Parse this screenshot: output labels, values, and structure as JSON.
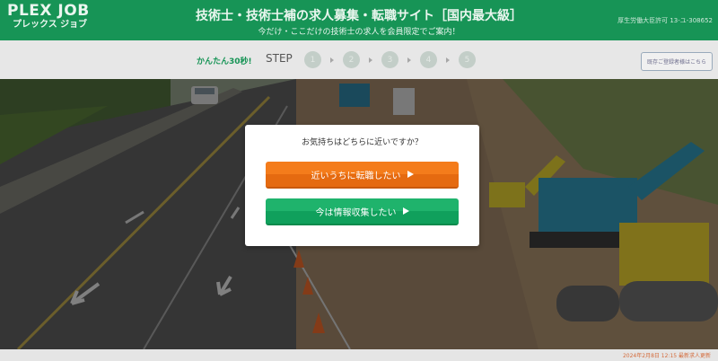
{
  "header": {
    "logo_main": "PLEX JOB",
    "logo_sub": "プレックス ジョブ",
    "title": "技術士・技術士補の求人募集・転職サイト［国内最大級］",
    "subtitle": "今だけ・ここだけの技術士の求人を会員限定でご案内！",
    "license": "厚生労働大臣許可 13-ユ-308652"
  },
  "stepbar": {
    "easy_label": "かんたん30秒!",
    "step_label": "STEP",
    "steps": [
      "1",
      "2",
      "3",
      "4",
      "5"
    ],
    "members_button": "既存ご登録者様はこちら"
  },
  "modal": {
    "question": "お気持ちはどちらに近いですか？",
    "option_soon": "近いうちに転職したい",
    "option_info": "今は情報収集したい"
  },
  "footer": {
    "updated": "2024年2月8日 12:15 最新求人更新"
  },
  "colors": {
    "brand_green": "#179456",
    "orange_button": "#f47c1b",
    "green_button": "#1fb36c"
  }
}
